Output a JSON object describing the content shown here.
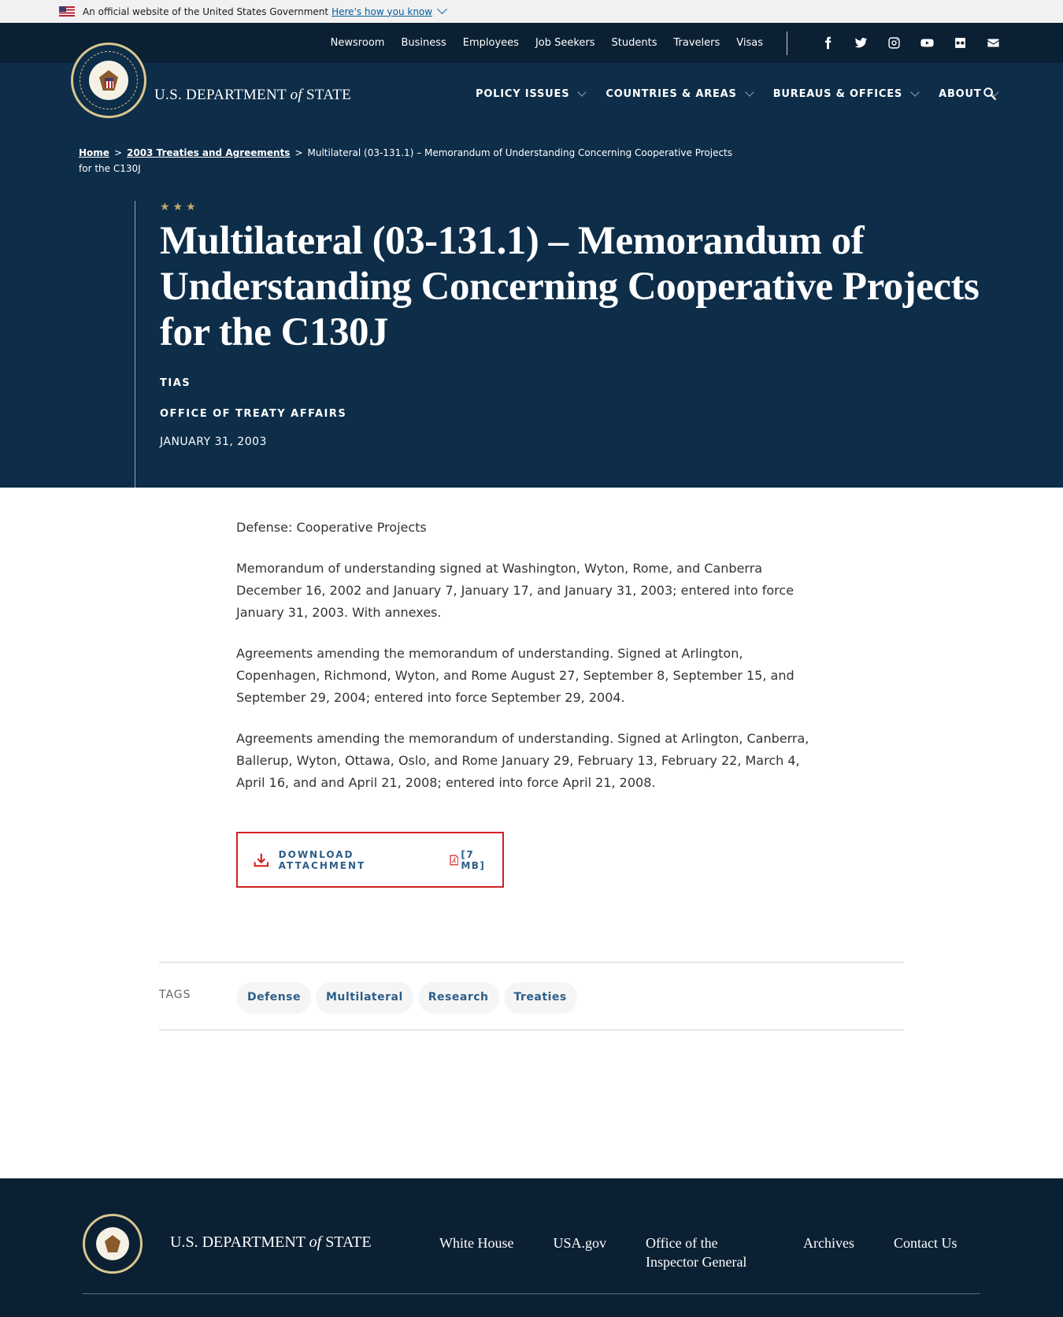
{
  "gov_banner": {
    "text": "An official website of the United States Government",
    "link": "Here's how you know"
  },
  "utility_nav": [
    "Newsroom",
    "Business",
    "Employees",
    "Job Seekers",
    "Students",
    "Travelers",
    "Visas"
  ],
  "social_icons": [
    "facebook-icon",
    "twitter-icon",
    "instagram-icon",
    "youtube-icon",
    "flickr-icon",
    "email-icon"
  ],
  "header": {
    "wordmark_pre": "U.S. DEPARTMENT ",
    "wordmark_of": "of",
    "wordmark_post": " STATE",
    "nav": [
      "POLICY ISSUES",
      "COUNTRIES & AREAS",
      "BUREAUS & OFFICES",
      "ABOUT"
    ]
  },
  "breadcrumb": {
    "home": "Home",
    "parent": "2003 Treaties and Agreements",
    "current": "Multilateral (03-131.1) – Memorandum of Understanding Concerning Cooperative Projects for the C130J",
    "separator": ">"
  },
  "article": {
    "stars": "★★★",
    "title": "Multilateral (03-131.1) – Memorandum of Understanding Concerning Cooperative Projects for the C130J",
    "series": "TIAS",
    "office": "OFFICE OF TREATY AFFAIRS",
    "date": "JANUARY 31, 2003",
    "paragraphs": [
      "Defense: Cooperative Projects",
      "Memorandum of understanding signed at Washington, Wyton, Rome, and Canberra December 16, 2002 and January 7, January 17, and January 31, 2003; entered into force January 31, 2003. With annexes.",
      "Agreements amending the memorandum of understanding. Signed at Arlington, Copenhagen, Richmond, Wyton, and Rome August 27, September 8, September 15, and September 29, 2004; entered into force September 29, 2004.",
      "Agreements amending the memorandum of understanding. Signed at Arlington, Canberra, Ballerup, Wyton, Ottawa, Oslo, and Rome January 29, February 13, February 22, March 4, April 16, and and April 21, 2008; entered into force April 21, 2008."
    ],
    "download_label": "DOWNLOAD ATTACHMENT",
    "download_size": "[7 MB]"
  },
  "tags": {
    "label": "TAGS",
    "items": [
      "Defense",
      "Multilateral",
      "Research",
      "Treaties"
    ]
  },
  "footer": {
    "wordmark_pre": "U.S. DEPARTMENT ",
    "wordmark_of": "of",
    "wordmark_post": " STATE",
    "links": [
      "White House",
      "USA.gov",
      "Office of the Inspector General",
      "Archives",
      "Contact Us"
    ]
  },
  "colors": {
    "navy": "#0d2d49",
    "dark_navy": "#0b2033",
    "accent_red": "#d42121",
    "link_blue": "#2d5e8a",
    "gold": "#c1aa6c"
  }
}
